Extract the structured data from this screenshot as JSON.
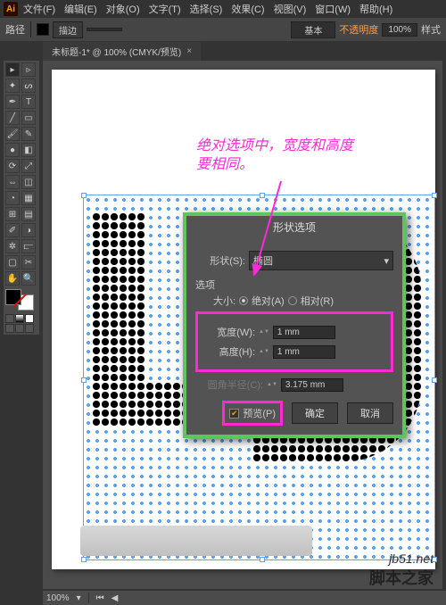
{
  "menu": {
    "file": "文件(F)",
    "edit": "编辑(E)",
    "object": "对象(O)",
    "type": "文字(T)",
    "select": "选择(S)",
    "effect": "效果(C)",
    "view": "视图(V)",
    "window": "窗口(W)",
    "help": "帮助(H)"
  },
  "options": {
    "label": "路径",
    "fill_label": "填色:",
    "stroke_label": "描边",
    "stroke_weight": "",
    "basic_label": "基本",
    "opacity_label": "不透明度",
    "opacity_value": "100%",
    "style_label": "样式"
  },
  "tab": {
    "title": "未标题-1* @ 100% (CMYK/预览)",
    "close": "×"
  },
  "annotation": {
    "line1": "绝对选项中，宽度和高度",
    "line2": "要相同。"
  },
  "dialog": {
    "title": "形状选项",
    "shape_label": "形状(S):",
    "shape_value": "椭圆",
    "options_label": "选项",
    "size_label": "大小:",
    "abs_label": "绝对(A)",
    "rel_label": "相对(R)",
    "width_label": "宽度(W):",
    "width_value": "1 mm",
    "height_label": "高度(H):",
    "height_value": "1 mm",
    "radius_label": "圆角半径(C):",
    "radius_value": "3.175 mm",
    "preview_label": "预览(P)",
    "ok": "确定",
    "cancel": "取消"
  },
  "watermark": {
    "url": "jb51.net",
    "cn": "脚本之家"
  },
  "statusbar": {
    "zoom": "100%"
  }
}
